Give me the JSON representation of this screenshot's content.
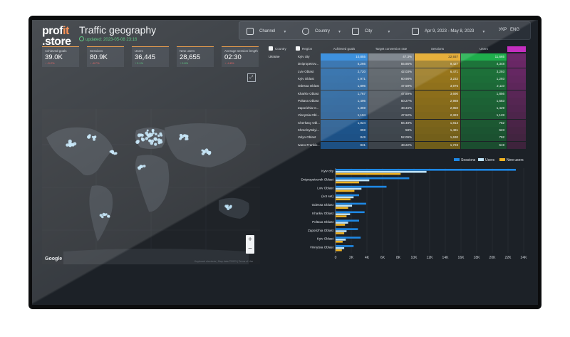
{
  "header": {
    "logo_line1_a": "prof",
    "logo_line1_b": "it",
    "logo_line2": ".store",
    "title": "Traffic geography",
    "updated": "updated: 2023-05-08 23:16"
  },
  "filters": {
    "channel": "Channel",
    "country": "Country",
    "city": "City",
    "date_range": "Apr 9, 2023 - May 8, 2023",
    "lang_ukr": "УКР",
    "lang_eng": "ENG"
  },
  "kpis": [
    {
      "label": "Achieved goals",
      "value": "39.0K",
      "delta": "↓ -9.2%",
      "trend": "down"
    },
    {
      "label": "Sessions",
      "value": "80.9K",
      "delta": "↓ -8.7%",
      "trend": "down"
    },
    {
      "label": "Users",
      "value": "36,445",
      "delta": "↑ 2.1%",
      "trend": "up"
    },
    {
      "label": "New users",
      "value": "28,655",
      "delta": "↑ 0.6%",
      "trend": "up"
    },
    {
      "label": "Average session length",
      "value": "02:30",
      "delta": "↓ -4.8%",
      "trend": "down"
    }
  ],
  "map": {
    "google": "Google",
    "attribution": "Keyboard shortcuts  |  Map data ©2023  |  Terms of Use",
    "zoom_in": "+",
    "zoom_out": "−"
  },
  "colors": {
    "sessions": "#1e88e5",
    "users": "#bfe3f7",
    "new_users": "#f0b323",
    "positive": "#3fbf6a",
    "negative": "#e54848",
    "accent": "#ff7a2f"
  },
  "table": {
    "headers": {
      "country": "Country",
      "region": "Region",
      "goals": "Achieved goals",
      "conversion": "Target conversion rate",
      "sessions": "Sessions",
      "users": "Users"
    },
    "country_value": "Ukraine",
    "rows": [
      {
        "region": "Kyiv city",
        "goals": "10,855",
        "conv": "47.3%",
        "sessions": "22,937",
        "users": "11,665"
      },
      {
        "region": "Dnipropetrov...",
        "goals": "5,266",
        "conv": "55.86%",
        "sessions": "9,427",
        "users": "4,348"
      },
      {
        "region": "Lviv Oblast",
        "goals": "2,720",
        "conv": "42.03%",
        "sessions": "6,471",
        "users": "3,293"
      },
      {
        "region": "Kyiv Oblast",
        "goals": "1,971",
        "conv": "60.98%",
        "sessions": "3,232",
        "users": "1,293"
      },
      {
        "region": "Odessa Oblast",
        "goals": "1,896",
        "conv": "47.59%",
        "sessions": "3,976",
        "users": "2,110"
      },
      {
        "region": "Kharkiv Oblast",
        "goals": "1,767",
        "conv": "47.89%",
        "sessions": "3,690",
        "users": "1,856"
      },
      {
        "region": "Poltava Oblast",
        "goals": "1,496",
        "conv": "50.27%",
        "sessions": "2,988",
        "users": "1,583"
      },
      {
        "region": "Zaporizhia O...",
        "goals": "1,369",
        "conv": "48.34%",
        "sessions": "2,850",
        "users": "1,429"
      },
      {
        "region": "Vinnytsia Obl...",
        "goals": "1,104",
        "conv": "47.52%",
        "sessions": "2,323",
        "users": "1,128"
      },
      {
        "region": "Cherkasy Obl...",
        "goals": "1,024",
        "conv": "56.48%",
        "sessions": "1,813",
        "users": "762"
      },
      {
        "region": "Khmelnytskyi...",
        "goals": "859",
        "conv": "58%",
        "sessions": "1,481",
        "users": "623"
      },
      {
        "region": "Volyn Oblast",
        "goals": "849",
        "conv": "52.09%",
        "sessions": "1,630",
        "users": "792"
      },
      {
        "region": "Ivano-Frankiv...",
        "goals": "831",
        "conv": "48.22%",
        "sessions": "1,723",
        "users": "619"
      }
    ]
  },
  "chart_data": {
    "type": "bar",
    "orientation": "horizontal",
    "categories": [
      "Kyiv city",
      "Dnipropetrovsk Oblast",
      "Lviv Oblast",
      "(not set)",
      "Odessa Oblast",
      "Kharkiv Oblast",
      "Poltava Oblast",
      "Zaporizhia Oblast",
      "Kyiv Oblast",
      "Vinnytsia Oblast"
    ],
    "series": [
      {
        "name": "Sessions",
        "values": [
          23000,
          9400,
          6500,
          3000,
          3900,
          3700,
          3000,
          2850,
          3200,
          2300
        ]
      },
      {
        "name": "Users",
        "values": [
          11600,
          4300,
          3300,
          2300,
          2100,
          1850,
          1600,
          1400,
          1300,
          1100
        ]
      },
      {
        "name": "New users",
        "values": [
          8300,
          3000,
          2400,
          1900,
          1600,
          1400,
          1200,
          1100,
          900,
          800
        ]
      }
    ],
    "xticks": [
      "0",
      "2K",
      "4K",
      "6K",
      "8K",
      "10K",
      "12K",
      "14K",
      "16K",
      "18K",
      "20K",
      "22K",
      "24K"
    ],
    "xlim": [
      0,
      24000
    ],
    "legend": "top-right",
    "grid": true
  }
}
